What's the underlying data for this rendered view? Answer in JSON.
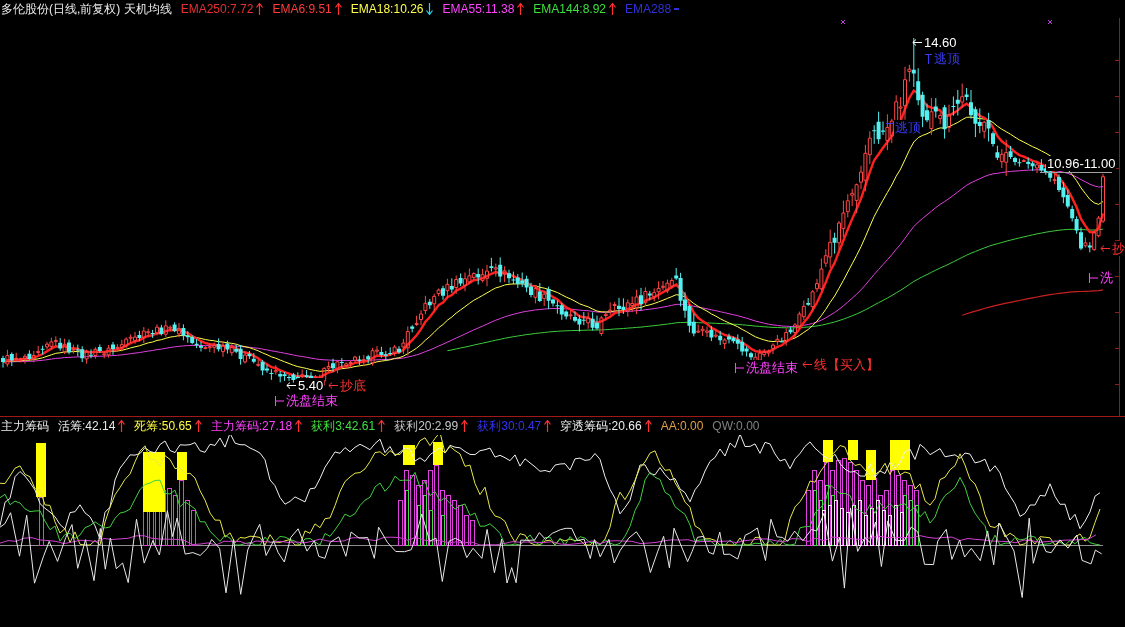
{
  "price_legend": {
    "title": "多伦股份(日线,前复权) 天机均线",
    "items": [
      {
        "label": "EMA250:7.72",
        "color": "#e83030",
        "kind": "rising"
      },
      {
        "label": "EMA6:9.51",
        "color": "#ff3c3c",
        "kind": "rising"
      },
      {
        "label": "EMA18:10.26",
        "color": "#ffff4c",
        "kind": "falling"
      },
      {
        "label": "EMA55:11.38",
        "color": "#ff44ff",
        "kind": "rising"
      },
      {
        "label": "EMA144:8.92",
        "color": "#3ce03c",
        "kind": "rising"
      },
      {
        "label": "EMA288",
        "color": "#3030d8",
        "kind": "flat"
      }
    ]
  },
  "price_chart": {
    "annotations": [
      {
        "kind": "price",
        "text": "14.60"
      },
      {
        "kind": "sell",
        "text": "逃顶"
      },
      {
        "kind": "sell",
        "text": "逃顶"
      },
      {
        "kind": "range",
        "text": "10.96-11.00"
      },
      {
        "kind": "price",
        "text": "5.40"
      },
      {
        "kind": "washout",
        "text": "洗盘结束"
      },
      {
        "kind": "buy",
        "text": "抄底"
      },
      {
        "kind": "washout",
        "text": "洗盘结束"
      },
      {
        "kind": "buy",
        "text": "线【买入】"
      },
      {
        "kind": "buy",
        "text": "抄"
      },
      {
        "kind": "washout",
        "text": "洗"
      }
    ]
  },
  "indicator_legend": {
    "title": "主力筹码",
    "items": [
      {
        "label": "活筹:42.14",
        "color": "#e8e8e8",
        "kind": "rising"
      },
      {
        "label": "死筹:50.65",
        "color": "#ffff40",
        "kind": "rising"
      },
      {
        "label": "主力筹码:27.18",
        "color": "#ff44ff",
        "kind": "rising"
      },
      {
        "label": "获利3:42.61",
        "color": "#40e040",
        "kind": "rising"
      },
      {
        "label": "获利20:2.99",
        "color": "#c8c8c8",
        "kind": "rising"
      },
      {
        "label": "获利30:0.47",
        "color": "#3434f0",
        "kind": "rising"
      },
      {
        "label": "穿透筹码:20.66",
        "color": "#f0f0f0",
        "kind": "rising"
      },
      {
        "label": "AA:0.00",
        "color": "#e0a040",
        "kind": "plain"
      },
      {
        "label": "QW:0.00",
        "color": "#808080",
        "kind": "plain"
      }
    ]
  }
}
